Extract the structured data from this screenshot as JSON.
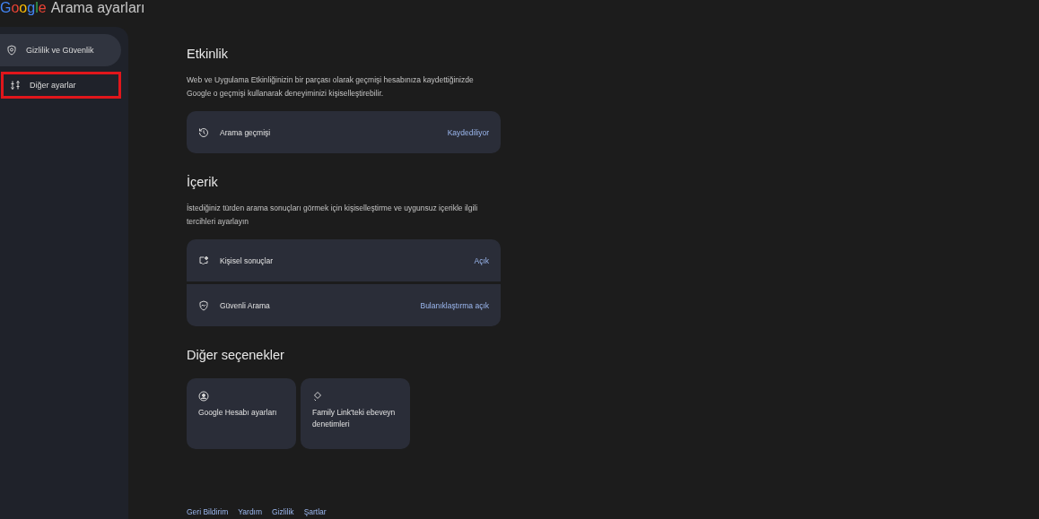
{
  "header": {
    "logo": "Google",
    "title": "Arama ayarları"
  },
  "sidebar": {
    "items": [
      {
        "label": "Gizlilik ve Güvenlik",
        "kind": "shield",
        "selected": true,
        "outlined": false
      },
      {
        "label": "Diğer ayarlar",
        "kind": "sliders",
        "selected": false,
        "outlined": true
      }
    ]
  },
  "sections": [
    {
      "title": "Etkinlik",
      "description": "Web ve Uygulama Etkinliğinizin bir parçası olarak geçmişi hesabınıza kaydettiğinizde Google o geçmişi kullanarak deneyiminizi kişiselleştirebilir.",
      "rows": [
        {
          "kind": "history",
          "label": "Arama geçmişi",
          "value": "Kaydediliyor"
        }
      ]
    },
    {
      "title": "İçerik",
      "description": "İstediğiniz türden arama sonuçları görmek için kişiselleştirme ve uygunsuz içerikle ilgili tercihleri ayarlayın",
      "rows": [
        {
          "kind": "sparkle",
          "label": "Kişisel sonuçlar",
          "value": "Açık"
        },
        {
          "kind": "safe",
          "label": "Güvenli Arama",
          "value": "Bulanıklaştırma açık"
        }
      ]
    }
  ],
  "other": {
    "title": "Diğer seçenekler",
    "cards": [
      {
        "kind": "account",
        "label": "Google Hesabı ayarları"
      },
      {
        "kind": "family",
        "label": "Family Link'teki ebeveyn denetimleri"
      }
    ]
  },
  "footer": [
    "Geri Bildirim",
    "Yardım",
    "Gizlilik",
    "Şartlar"
  ]
}
